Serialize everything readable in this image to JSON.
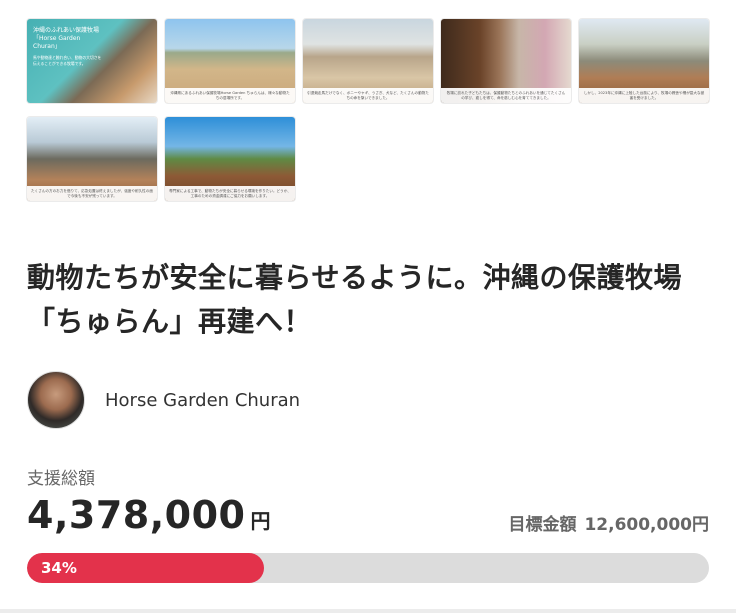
{
  "gallery": [
    {
      "overlay_title": "沖縄のふれあい保護牧場「Horse Garden Churan」",
      "overlay_sub": "馬や動物達と触れ合い、動物の大切さを伝えることができる牧場です。",
      "caption": ""
    },
    {
      "caption": "沖縄県にあるふれあい保護牧場Horse Garden ちゅらんは、様々な動物たちの居場所です。"
    },
    {
      "caption": "引退競走馬だけでなく、ポニーやヤギ、うさぎ、犬など、たくさんの動物たちの命を繋いできました。"
    },
    {
      "caption": "牧場に訪れた子どもたちは、保護動物たちとのふれあいを通じてたくさんの学び、癒しを得て、命を慈しむ心を育ててきました。"
    },
    {
      "caption": "しかし、2023年に沖縄に上陸した台風により、牧場の厩舎や柵が甚大な被害を受けました。"
    },
    {
      "caption": "たくさんの方のお力を借りて、応急処置は終えましたが、強度や耐久性の面で今後も不安が残っています。"
    },
    {
      "caption": "専門家による工事で、動物たちが安全に暮らせる環境を作りたい。どうか、工事のための資金調達にご協力をお願いします。"
    }
  ],
  "project": {
    "title": "動物たちが安全に暮らせるように。沖縄の保護牧場「ちゅらん」再建へ！",
    "owner_name": "Horse Garden Churan"
  },
  "funding": {
    "support_label": "支援総額",
    "amount": "4,378,000",
    "amount_unit": "円",
    "goal_label": "目標金額",
    "goal_value": "12,600,000円",
    "progress_text": "34%",
    "progress_fraction": 0.347,
    "bar_color": "#e3324b",
    "track_color": "#dcdcdc"
  }
}
